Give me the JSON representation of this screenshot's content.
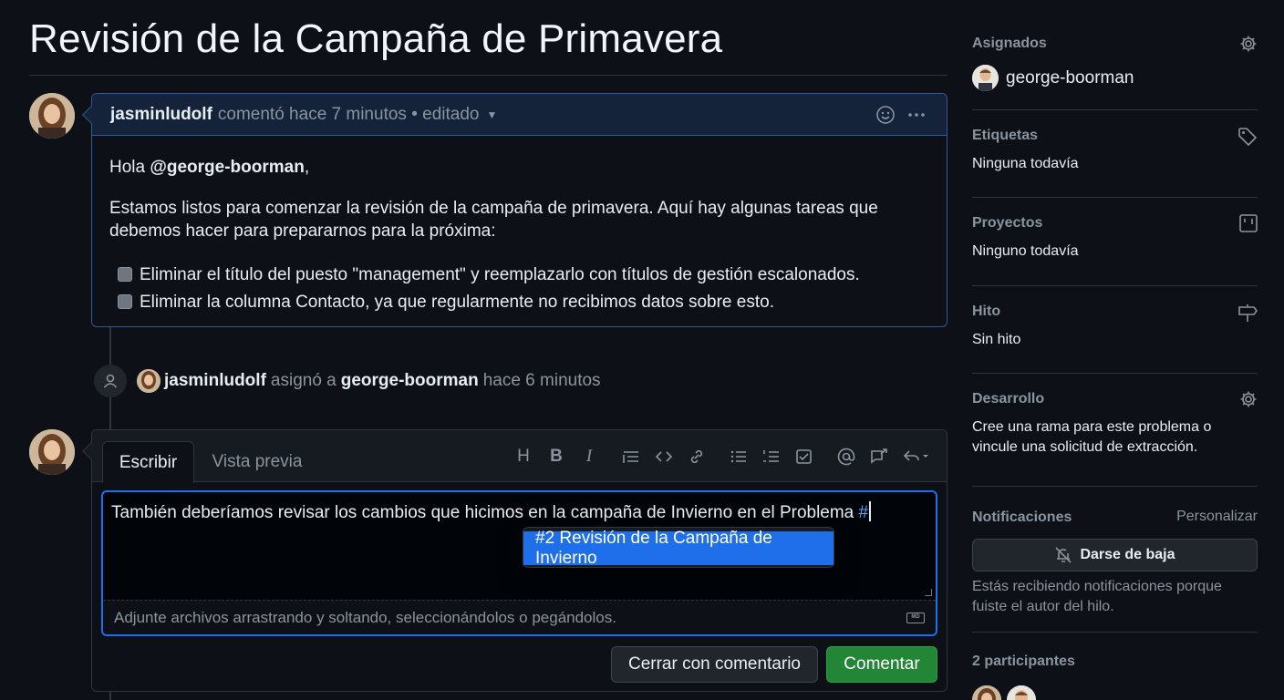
{
  "issue": {
    "title": "Revisión de la Campaña de Primavera"
  },
  "comment": {
    "author": "jasminludolf",
    "meta": "comentó hace 7 minutos • editado",
    "greeting_prefix": "Hola ",
    "greeting_mention": "@george-boorman",
    "greeting_suffix": ",",
    "paragraph": "Estamos listos para comenzar la revisión de la campaña de primavera. Aquí hay algunas tareas que debemos hacer para prepararnos para la próxima:",
    "tasks": [
      {
        "label": "Eliminar el título del puesto \"management\" y reemplazarlo con títulos de gestión escalonados.",
        "checked": false
      },
      {
        "label": "Eliminar la columna Contacto, ya que regularmente no recibimos datos sobre esto.",
        "checked": false
      }
    ]
  },
  "event": {
    "actor": "jasminludolf",
    "verb": "asignó a",
    "assignee": "george-boorman",
    "time": "hace 6 minutos"
  },
  "editor": {
    "tab_write": "Escribir",
    "tab_preview": "Vista previa",
    "toolbar": {
      "heading": "H",
      "bold": "B",
      "italic": "I"
    },
    "text_before": "También deberíamos revisar los cambios que hicimos en la campaña de Invierno en el Problema ",
    "text_hash": "#",
    "attach_hint": "Adjunte archivos arrastrando y soltando, seleccionándolos o pegándolos.",
    "markdown_badge": "MD",
    "suggestion": "#2 Revisión de la Campaña de Invierno",
    "close_button": "Cerrar con comentario",
    "comment_button": "Comentar"
  },
  "sidebar": {
    "assignees": {
      "heading": "Asignados",
      "user": "george-boorman"
    },
    "labels": {
      "heading": "Etiquetas",
      "value": "Ninguna todavía"
    },
    "projects": {
      "heading": "Proyectos",
      "value": "Ninguno todavía"
    },
    "milestone": {
      "heading": "Hito",
      "value": "Sin hito"
    },
    "development": {
      "heading": "Desarrollo",
      "value": "Cree una rama para este problema o vincule una solicitud de extracción."
    },
    "notifications": {
      "heading": "Notificaciones",
      "customize": "Personalizar",
      "button": "Darse de baja",
      "note": "Estás recibiendo notificaciones porque fuiste el autor del hilo."
    },
    "participants": {
      "heading": "2 participantes"
    }
  },
  "colors": {
    "background": "#0d1117",
    "accent": "#1f6feb",
    "success": "#238636",
    "muted": "#8b949e"
  }
}
